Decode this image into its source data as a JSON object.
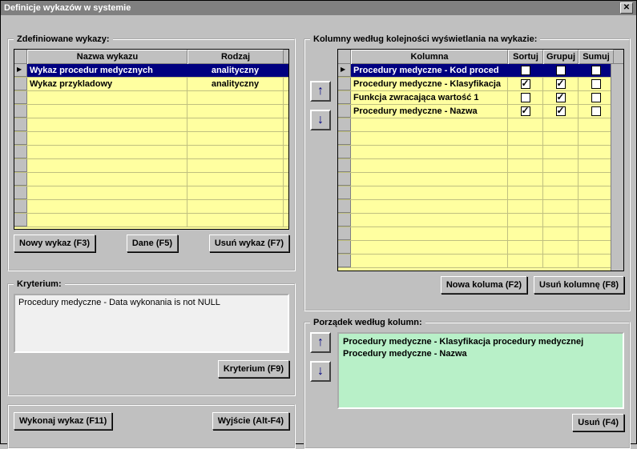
{
  "title": "Definicje wykazów w systemie",
  "leftPanel": {
    "legend": "Zdefiniowane wykazy:",
    "cols": {
      "name": "Nazwa wykazu",
      "type": "Rodzaj"
    },
    "rows": [
      {
        "name": "Wykaz procedur medycznych",
        "type": "analityczny",
        "selected": true
      },
      {
        "name": "Wykaz przykladowy",
        "type": "analityczny",
        "selected": false
      }
    ],
    "buttons": {
      "new": "Nowy wykaz (F3)",
      "data": "Dane (F5)",
      "del": "Usuń wykaz (F7)"
    }
  },
  "criteria": {
    "legend": "Kryterium:",
    "text": "Procedury medyczne - Data wykonania is not NULL",
    "button": "Kryterium (F9)"
  },
  "bottom": {
    "run": "Wykonaj wykaz (F11)",
    "exit": "Wyjście (Alt-F4)"
  },
  "columnsPanel": {
    "legend": "Kolumny według kolejności wyświetlania na wykazie:",
    "cols": {
      "name": "Kolumna",
      "sort": "Sortuj",
      "group": "Grupuj",
      "sum": "Sumuj"
    },
    "rows": [
      {
        "name": "Procedury medyczne - Kod proced",
        "sort": false,
        "group": false,
        "sum": false,
        "selected": true
      },
      {
        "name": "Procedury medyczne - Klasyfikacja",
        "sort": true,
        "group": true,
        "sum": false
      },
      {
        "name": "Funkcja zwracająca wartość 1",
        "sort": false,
        "group": true,
        "sum": false
      },
      {
        "name": "Procedury medyczne - Nazwa",
        "sort": true,
        "group": true,
        "sum": false
      }
    ],
    "buttons": {
      "new": "Nowa koluma (F2)",
      "del": "Usuń kolumnę (F8)"
    }
  },
  "orderPanel": {
    "legend": "Porządek według kolumn:",
    "items": [
      "Procedury medyczne - Klasyfikacja procedury medycznej",
      "Procedury medyczne - Nazwa"
    ],
    "button": "Usuń (F4)"
  }
}
